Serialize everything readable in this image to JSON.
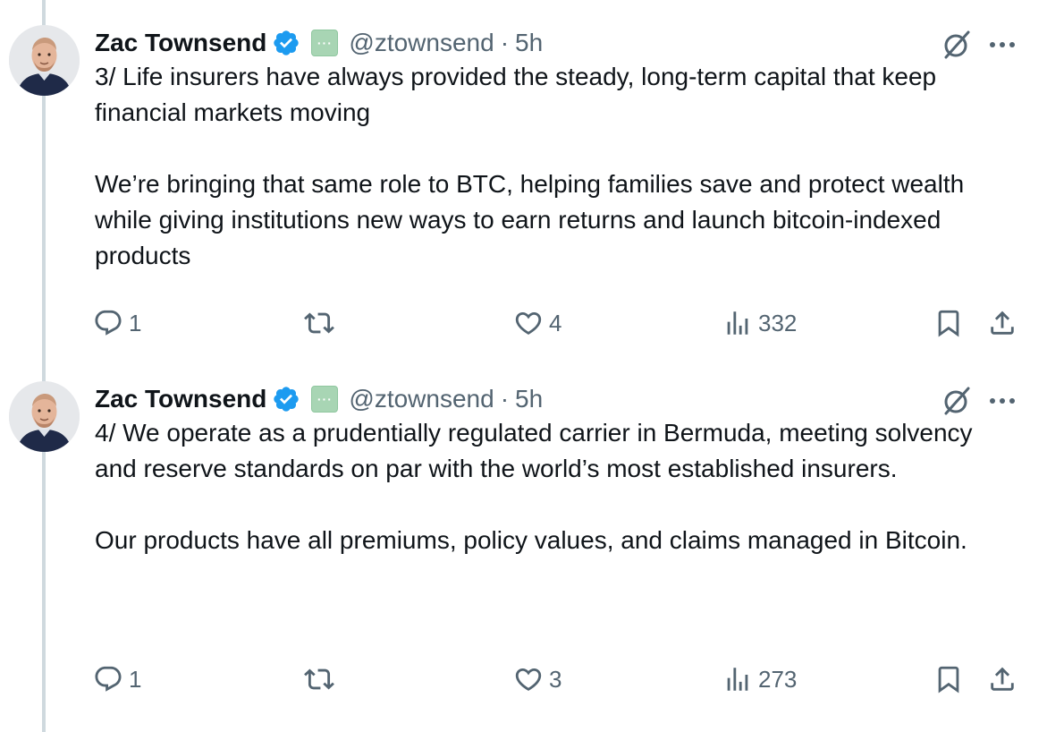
{
  "tweets": [
    {
      "author_name": "Zac Townsend",
      "handle": "@ztownsend",
      "separator": "·",
      "time": "5h",
      "affiliation_badge": "···",
      "paragraphs": [
        "3/ Life insurers have always provided the steady, long-term capital that keep financial markets moving",
        "We’re bringing that same role to BTC, helping families save and protect wealth while giving institutions new ways to earn returns and launch bitcoin-indexed products"
      ],
      "replies": "1",
      "reposts": "",
      "likes": "4",
      "views": "332"
    },
    {
      "author_name": "Zac Townsend",
      "handle": "@ztownsend",
      "separator": "·",
      "time": "5h",
      "affiliation_badge": "···",
      "paragraphs": [
        "4/ We operate as a prudentially regulated carrier in Bermuda, meeting solvency and reserve standards on par with the world’s most established insurers.",
        "Our products have all premiums, policy values, and claims managed in Bitcoin."
      ],
      "replies": "1",
      "reposts": "",
      "likes": "3",
      "views": "273"
    }
  ],
  "colors": {
    "text": "#0f1419",
    "secondary": "#536471",
    "verified": "#1d9bf0",
    "thread_line": "#cfd9de",
    "affiliation_badge": "#a8d5b4"
  },
  "icons": [
    "verified-badge-icon",
    "affiliation-badge-icon",
    "grok-icon",
    "more-icon",
    "reply-icon",
    "repost-icon",
    "like-icon",
    "views-icon",
    "bookmark-icon",
    "share-icon"
  ]
}
